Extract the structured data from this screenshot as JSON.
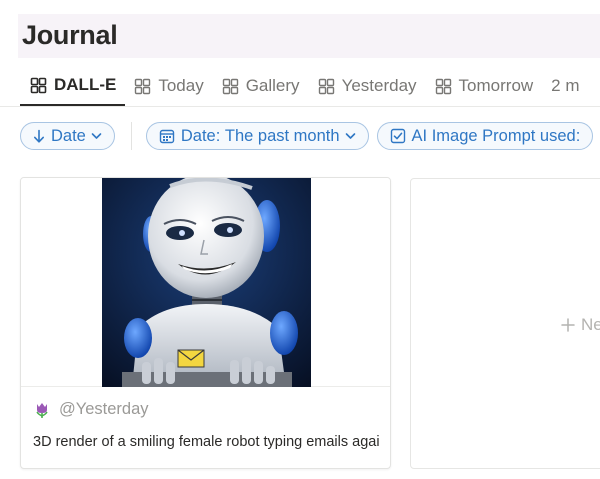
{
  "page": {
    "title": "Journal"
  },
  "tabs": [
    {
      "label": "DALL-E",
      "active": true,
      "icon": "gallery-icon"
    },
    {
      "label": "Today",
      "icon": "gallery-icon"
    },
    {
      "label": "Gallery",
      "icon": "gallery-icon"
    },
    {
      "label": "Yesterday",
      "icon": "gallery-icon"
    },
    {
      "label": "Tomorrow",
      "icon": "gallery-icon"
    },
    {
      "label": "2 m"
    }
  ],
  "filters": {
    "sort": {
      "label": "Date",
      "icon": "arrow-down-icon"
    },
    "date": {
      "prefix": "Date:",
      "value": "The past month",
      "icon": "calendar-icon"
    },
    "prompt": {
      "prefix": "AI Image Prompt used:",
      "icon": "checkbox-icon"
    }
  },
  "card": {
    "date": "@Yesterday",
    "text": "3D render of a smiling female robot typing emails agai",
    "emoji": "tulip-icon"
  },
  "new_card": {
    "label": "Ne"
  },
  "colors": {
    "accent": "#2f77c4",
    "pill_border": "#a9c5e3",
    "title_bar": "#f7f3f8"
  }
}
